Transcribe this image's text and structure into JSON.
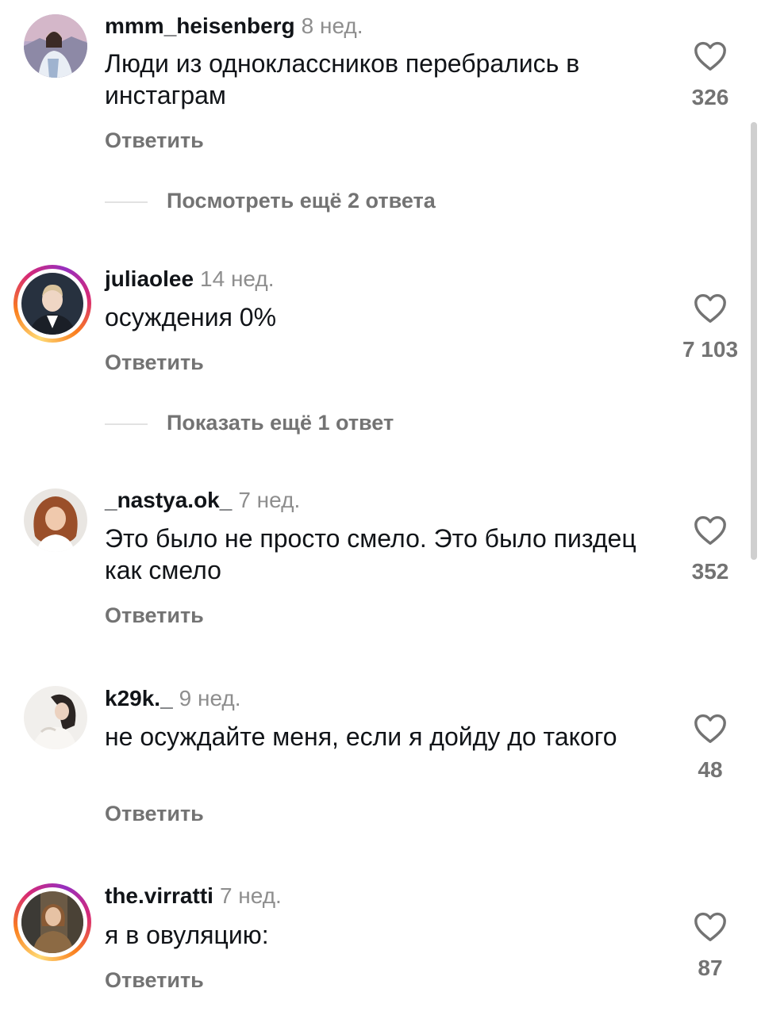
{
  "comments": [
    {
      "username": "mmm_heisenberg",
      "time": "8 нед.",
      "text": "Люди из одноклассников перебрались в инстаграм",
      "reply_label": "Ответить",
      "likes": "326",
      "story_ring": false,
      "more_replies": "Посмотреть ещё 2 ответа"
    },
    {
      "username": "juliaolee",
      "time": "14 нед.",
      "text": "осуждения 0%",
      "reply_label": "Ответить",
      "likes": "7 103",
      "story_ring": true,
      "more_replies": "Показать ещё 1 ответ"
    },
    {
      "username": "_nastya.ok_",
      "time": "7 нед.",
      "text": "Это было не просто смело. Это было пиздец как смело",
      "reply_label": "Ответить",
      "likes": "352",
      "story_ring": false
    },
    {
      "username": "k29k._",
      "time": "9 нед.",
      "text": "не осуждайте меня, если я дойду до такого",
      "reply_label": "Ответить",
      "likes": "48",
      "story_ring": false
    },
    {
      "username": "the.virratti",
      "time": "7 нед.",
      "text": "я в овуляцию:",
      "reply_label": "Ответить",
      "likes": "87",
      "story_ring": true
    }
  ],
  "icons": {
    "like": "heart-outline-icon"
  },
  "colors": {
    "text": "#111418",
    "secondary": "#737373",
    "timestamp": "#8e8e8e",
    "story_ring": [
      "#feda75",
      "#fa7e1e",
      "#d62976",
      "#962fbf"
    ]
  }
}
